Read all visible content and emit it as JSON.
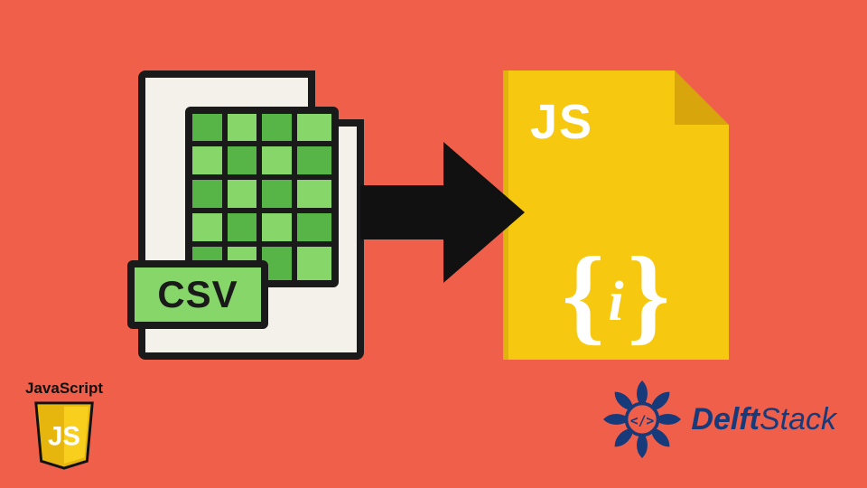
{
  "colors": {
    "background": "#f05f4a",
    "csv_paper": "#f4f1eb",
    "csv_green": "#87d66a",
    "csv_green_dark": "#57b447",
    "stroke": "#1a1a1a",
    "js_yellow": "#f6c80f",
    "js_yellow_dark": "#d9a50c",
    "js_text": "#ffffff",
    "brand_blue": "#173a7a"
  },
  "csv": {
    "badge_label": "CSV"
  },
  "arrow": {
    "name": "right-arrow-icon"
  },
  "js": {
    "label": "JS",
    "brace_left": "{",
    "brace_right": "}",
    "semicolon": "i"
  },
  "js_shield": {
    "label": "JavaScript",
    "monogram": "JS"
  },
  "brand": {
    "name_first": "Delft",
    "name_second": "Stack"
  }
}
